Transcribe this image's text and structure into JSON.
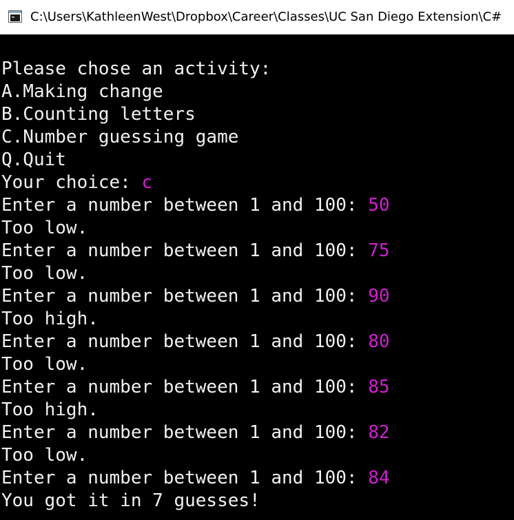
{
  "window": {
    "title": "C:\\Users\\KathleenWest\\Dropbox\\Career\\Classes\\UC San Diego Extension\\C#",
    "icon": "console-window-icon",
    "colors": {
      "background": "#000000",
      "text": "#f2f2f2",
      "input": "#d21fd2",
      "titlebar": "#ffffff"
    }
  },
  "console": {
    "lines": [
      {
        "text": "Please chose an activity:",
        "input": ""
      },
      {
        "text": "A.Making change",
        "input": ""
      },
      {
        "text": "B.Counting letters",
        "input": ""
      },
      {
        "text": "C.Number guessing game",
        "input": ""
      },
      {
        "text": "Q.Quit",
        "input": ""
      },
      {
        "text": "Your choice: ",
        "input": "c"
      },
      {
        "text": "Enter a number between 1 and 100: ",
        "input": "50"
      },
      {
        "text": "Too low.",
        "input": ""
      },
      {
        "text": "Enter a number between 1 and 100: ",
        "input": "75"
      },
      {
        "text": "Too low.",
        "input": ""
      },
      {
        "text": "Enter a number between 1 and 100: ",
        "input": "90"
      },
      {
        "text": "Too high.",
        "input": ""
      },
      {
        "text": "Enter a number between 1 and 100: ",
        "input": "80"
      },
      {
        "text": "Too low.",
        "input": ""
      },
      {
        "text": "Enter a number between 1 and 100: ",
        "input": "85"
      },
      {
        "text": "Too high.",
        "input": ""
      },
      {
        "text": "Enter a number between 1 and 100: ",
        "input": "82"
      },
      {
        "text": "Too low.",
        "input": ""
      },
      {
        "text": "Enter a number between 1 and 100: ",
        "input": "84"
      },
      {
        "text": "You got it in 7 guesses!",
        "input": ""
      }
    ]
  }
}
